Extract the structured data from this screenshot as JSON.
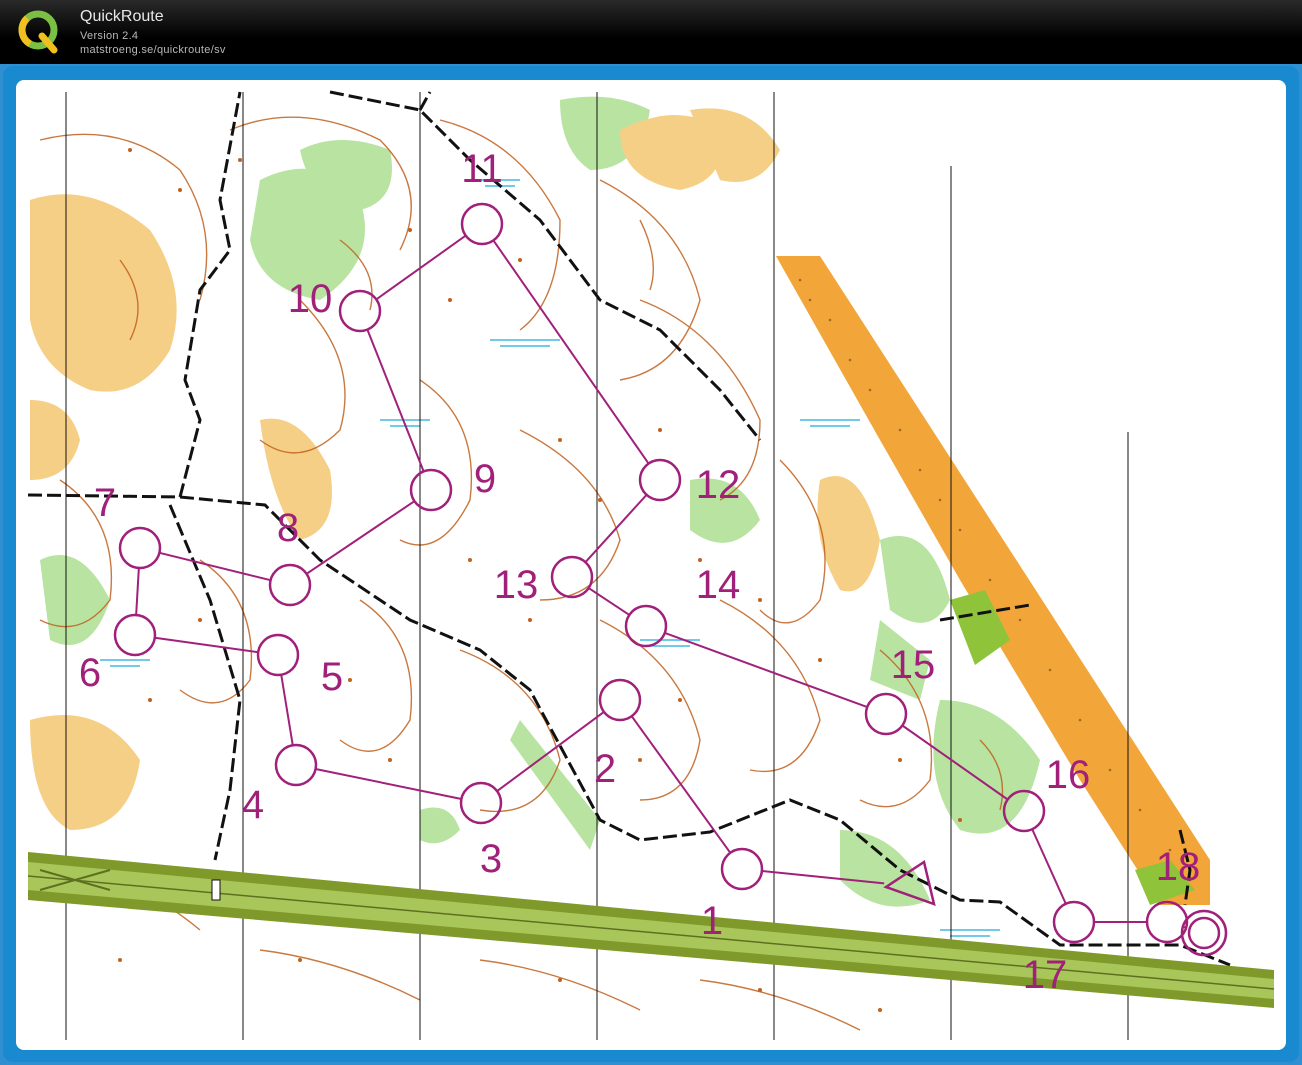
{
  "app": {
    "title": "QuickRoute",
    "version": "Version 2.4",
    "url": "matstroeng.se/quickroute/sv",
    "logo_letter": "Q"
  },
  "colors": {
    "course": "#a0207a",
    "frame": "#1a8ad0",
    "open_land": "#f6c46a",
    "vegetation": "#a9dc8e",
    "contour": "#b5541a",
    "water": "#40b8e0",
    "motorway": "#7f9a2a"
  },
  "course": {
    "start_label": "1",
    "controls": [
      "1",
      "2",
      "3",
      "4",
      "5",
      "6",
      "7",
      "8",
      "9",
      "10",
      "11",
      "12",
      "13",
      "14",
      "15",
      "16",
      "17",
      "18"
    ]
  }
}
